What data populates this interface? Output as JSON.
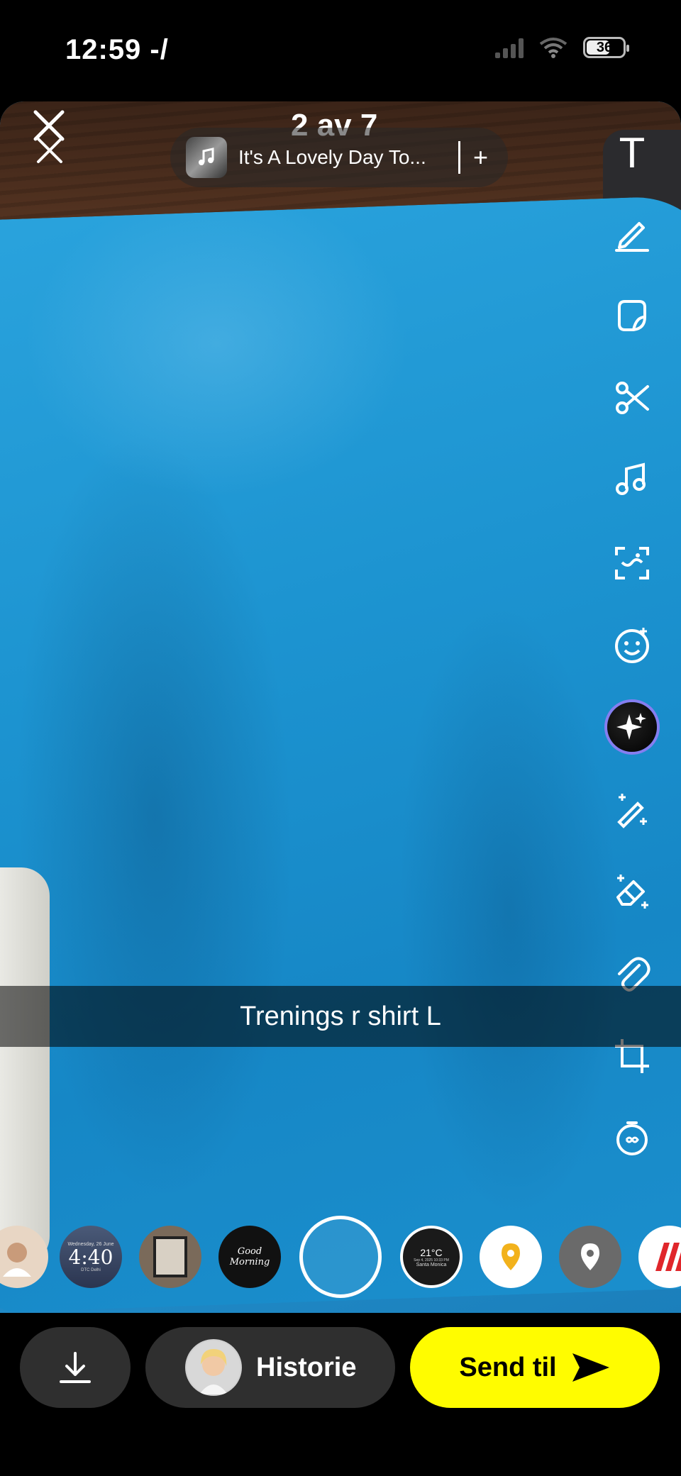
{
  "status_bar": {
    "time": "12:59 -/",
    "battery_percent": "36"
  },
  "header": {
    "story_counter": "2 av 7",
    "music": {
      "title": "It's A Lovely Day To...",
      "add_label": "+"
    }
  },
  "toolbar": {
    "text_tool_label": "T",
    "items": [
      "text-icon",
      "pencil-icon",
      "sticker-icon",
      "scissors-icon",
      "music-note-icon",
      "scan-icon",
      "emoji-face-icon",
      "ai-sparkle-icon",
      "magic-wand-icon",
      "eraser-icon",
      "paperclip-icon",
      "crop-icon",
      "timer-loop-icon"
    ]
  },
  "caption": {
    "text": "Trenings r shirt L"
  },
  "lenses": {
    "clock_time": "4:40",
    "clock_date": "Wednesday, 26 June",
    "clock_sub": "DTC Delhi",
    "good_morning": "Good Morning",
    "weather_temp": "21°C",
    "weather_location": "Santa Monica",
    "weather_date": "Sep 4, 2025 10:33 PM"
  },
  "bottom_bar": {
    "story_label": "Historie",
    "send_label": "Send til"
  },
  "colors": {
    "send_button": "#fffc00",
    "dark_button": "#2f2f2f",
    "ai_ring": "#b478ff"
  }
}
